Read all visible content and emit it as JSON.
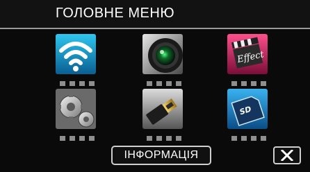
{
  "header": {
    "title": "ГОЛОВНЕ МЕНЮ"
  },
  "menu": {
    "items": [
      {
        "icon": "wifi-icon"
      },
      {
        "icon": "camera-lens-icon"
      },
      {
        "icon": "effect-clapperboard-icon"
      },
      {
        "icon": "settings-gears-icon"
      },
      {
        "icon": "hdmi-connector-icon"
      },
      {
        "icon": "sd-card-icon"
      }
    ]
  },
  "footer": {
    "info_label": "ІНФОРМАЦІЯ",
    "close_icon": "close-icon"
  }
}
